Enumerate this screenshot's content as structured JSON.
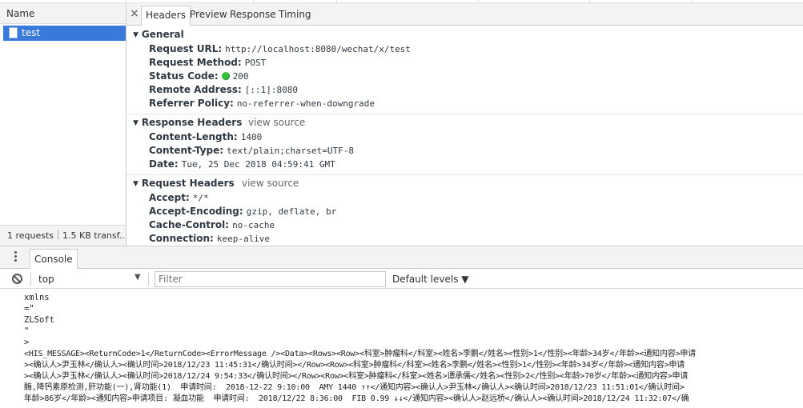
{
  "list": {
    "column_header": "Name",
    "rows": [
      {
        "name": "test"
      }
    ],
    "status": {
      "requests": "1 requests",
      "transferred": "1.5 KB transf..."
    }
  },
  "detail": {
    "close_glyph": "×",
    "tabs": [
      "Headers",
      "Preview",
      "Response",
      "Timing"
    ],
    "active_tab": "Headers",
    "general": {
      "title": "General",
      "rows": [
        {
          "key": "Request URL:",
          "value": "http://localhost:8080/wechat/x/test"
        },
        {
          "key": "Request Method:",
          "value": "POST"
        },
        {
          "key": "Status Code:",
          "value": "200",
          "status_color": "#34c13e"
        },
        {
          "key": "Remote Address:",
          "value": "[::1]:8080"
        },
        {
          "key": "Referrer Policy:",
          "value": "no-referrer-when-downgrade"
        }
      ]
    },
    "response_headers": {
      "title": "Response Headers",
      "view_source": "view source",
      "rows": [
        {
          "key": "Content-Length:",
          "value": "1400"
        },
        {
          "key": "Content-Type:",
          "value": "text/plain;charset=UTF-8"
        },
        {
          "key": "Date:",
          "value": "Tue, 25 Dec 2018 04:59:41 GMT"
        }
      ]
    },
    "request_headers": {
      "title": "Request Headers",
      "view_source": "view source",
      "rows": [
        {
          "key": "Accept:",
          "value": "*/*"
        },
        {
          "key": "Accept-Encoding:",
          "value": "gzip, deflate, br"
        },
        {
          "key": "Cache-Control:",
          "value": "no-cache"
        },
        {
          "key": "Connection:",
          "value": "keep-alive"
        }
      ]
    }
  },
  "drawer": {
    "tab": "Console",
    "context": "top",
    "filter_placeholder": "Filter",
    "levels": "Default levels ▼"
  },
  "console": {
    "lines": [
      "xmlns",
      "=\"",
      "ZLSoft",
      "\"",
      ">"
    ],
    "xml_lines": [
      "<HIS_MESSAGE><ReturnCode>1</ReturnCode><ErrorMessage /><Data><Rows><Row><科室>肿瘤科</科室><姓名>李鹏</姓名><性别>1</性别><年龄>34岁</年龄><通知内容>申请",
      "><确认人>尹玉林</确认人><确认时间>2018/12/23 11:45:31</确认时间></Row><Row><科室>肿瘤科</科室><姓名>李鹏</姓名><性别>1</性别><年龄>34岁</年龄><通知内容>申请",
      "><确认人>尹玉林</确认人><确认时间>2018/12/24 9:54:33</确认时间></Row><Row><科室>肿瘤科</科室><姓名>谭承儒</姓名><性别>2</性别><年龄>70岁</年龄><通知内容>申请",
      "酶,降钙素原检测,肝功能(一),肾功能(1)  申请时间:  2018-12-22 9:10:00  AMY 1440 ↑↑</通知内容><确认人>尹玉林</确认人><确认时间>2018/12/23 11:51:01</确认时间>",
      "年龄>86岁</年龄><通知内容>申请项目: 凝血功能  申请时间:  2018/12/22 8:36:00  FIB 0.99 ↓↓</通知内容><确认人>赵远桥</确认人><确认时间>2018/12/24 11:32:07</确"
    ]
  }
}
